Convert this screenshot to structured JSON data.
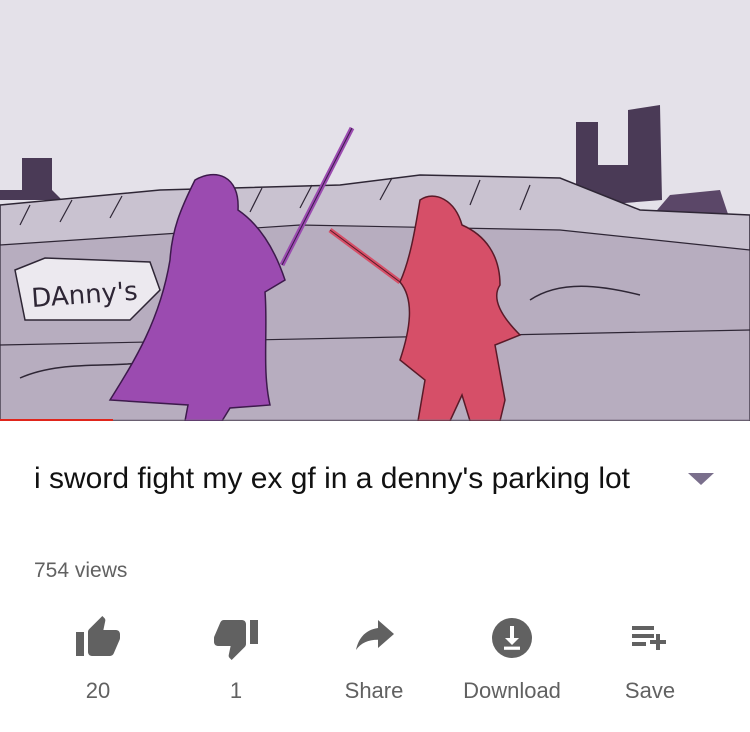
{
  "video": {
    "sign_text": "DAnny's",
    "progress_percent": 15,
    "colors": {
      "progress": "#e0251b",
      "figure_left": "#9b4bb0",
      "figure_right": "#d64f68",
      "sky": "#e4e1e9"
    }
  },
  "title": "i sword fight my ex gf in a denny's parking lot",
  "views": "754 views",
  "expand_icon": "chevron-down-icon",
  "actions": [
    {
      "icon": "thumbs-up-icon",
      "label": "20"
    },
    {
      "icon": "thumbs-down-icon",
      "label": "1"
    },
    {
      "icon": "share-icon",
      "label": "Share"
    },
    {
      "icon": "download-icon",
      "label": "Download"
    },
    {
      "icon": "save-playlist-icon",
      "label": "Save"
    }
  ]
}
